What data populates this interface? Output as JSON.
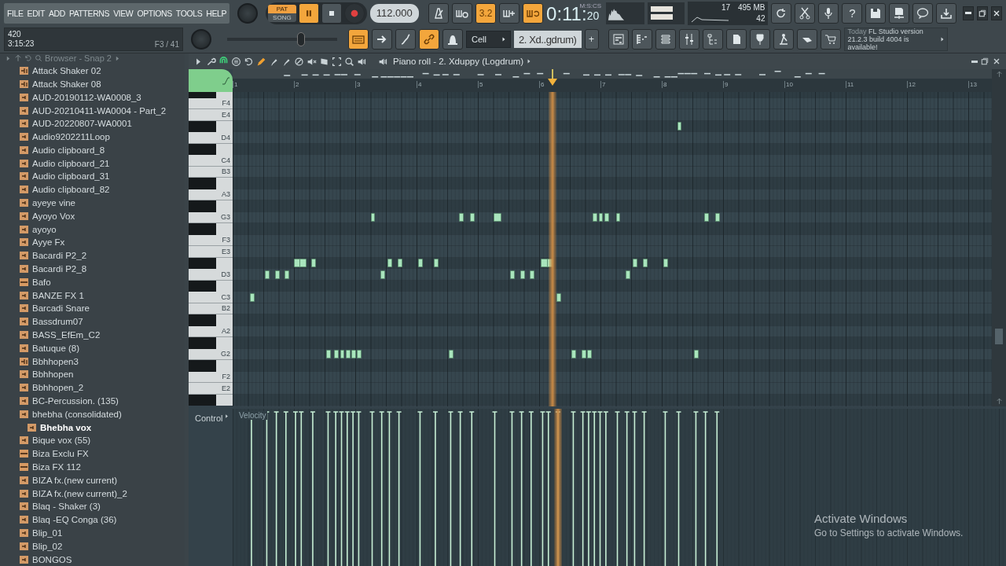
{
  "menu": [
    "FILE",
    "EDIT",
    "ADD",
    "PATTERNS",
    "VIEW",
    "OPTIONS",
    "TOOLS",
    "HELP"
  ],
  "hint_panel": {
    "line_1": "420",
    "line_2": "3:15:23",
    "position": "F3 / 41"
  },
  "transport": {
    "pat_label": "PAT",
    "song_label": "SONG",
    "pattern_mode": true,
    "playing": true
  },
  "tempo": "112.000",
  "row_1_toggles": [
    {
      "on": false
    },
    {
      "on": false
    },
    {
      "on": true,
      "label": "3.2"
    },
    {
      "on": false
    },
    {
      "on": true
    }
  ],
  "time": {
    "unit": "M:S:CS",
    "main": "0:11:",
    "small": "20"
  },
  "monitor": {
    "cpu": "17",
    "memory": "495 MB",
    "polyphony": "42"
  },
  "help_label": "?",
  "main_slider": {
    "level": 0.67
  },
  "row_2_toggles": [
    {
      "on": true
    },
    {
      "on": false
    },
    {
      "on": false
    },
    {
      "on": true
    },
    {
      "on": false
    }
  ],
  "snap": "Cell",
  "pattern": "2. Xd..gdrum)",
  "add_pattern": "+",
  "news": {
    "day": "Today",
    "text": "FL Studio version 21.2.3 build 4004 is available!"
  },
  "browser": {
    "title": "Browser - Snap 2",
    "items": [
      {
        "name": "Attack Shaker 02",
        "kind": "loop",
        "selected": false
      },
      {
        "name": "Attack Shaker 08",
        "kind": "loop",
        "selected": false
      },
      {
        "name": "AUD-20190112-WA0008_3",
        "kind": "audio",
        "selected": false
      },
      {
        "name": "AUD-20210411-WA0004 - Part_2",
        "kind": "audio",
        "selected": false
      },
      {
        "name": "AUD-20220807-WA0001",
        "kind": "audio",
        "selected": false
      },
      {
        "name": "Audio9202211Loop",
        "kind": "audio",
        "selected": false
      },
      {
        "name": "Audio clipboard_8",
        "kind": "audio",
        "selected": false
      },
      {
        "name": "Audio clipboard_21",
        "kind": "audio",
        "selected": false
      },
      {
        "name": "Audio clipboard_31",
        "kind": "audio",
        "selected": false
      },
      {
        "name": "Audio clipboard_82",
        "kind": "audio",
        "selected": false
      },
      {
        "name": "ayeye vine",
        "kind": "audio",
        "selected": false
      },
      {
        "name": "Ayoyo Vox",
        "kind": "audio",
        "selected": false
      },
      {
        "name": "ayoyo",
        "kind": "audio",
        "selected": false
      },
      {
        "name": "Ayye Fx",
        "kind": "audio",
        "selected": false
      },
      {
        "name": "Bacardi P2_2",
        "kind": "audio",
        "selected": false
      },
      {
        "name": "Bacardi P2_8",
        "kind": "audio",
        "selected": false
      },
      {
        "name": "Bafo",
        "kind": "mp3",
        "selected": false
      },
      {
        "name": "BANZE FX 1",
        "kind": "audio",
        "selected": false
      },
      {
        "name": "Barcadi Snare",
        "kind": "audio",
        "selected": false
      },
      {
        "name": "Bassdrum07",
        "kind": "audio",
        "selected": false
      },
      {
        "name": "BASS_EfEm_C2",
        "kind": "audio",
        "selected": false
      },
      {
        "name": "Batuque  (8)",
        "kind": "audio",
        "selected": false
      },
      {
        "name": "Bbhhopen3",
        "kind": "loop",
        "selected": false
      },
      {
        "name": "Bbhhopen",
        "kind": "audio",
        "selected": false
      },
      {
        "name": "Bbhhopen_2",
        "kind": "audio",
        "selected": false
      },
      {
        "name": "BC-Percussion. (135)",
        "kind": "audio",
        "selected": false
      },
      {
        "name": "bhebha (consolidated)",
        "kind": "audio",
        "selected": false,
        "children": [
          {
            "name": "Bhebha vox",
            "kind": "audio",
            "selected": true
          }
        ]
      },
      {
        "name": "Bique vox (55)",
        "kind": "audio",
        "selected": false
      },
      {
        "name": "Biza Exclu FX",
        "kind": "mp3",
        "selected": false
      },
      {
        "name": "Biza FX 112",
        "kind": "mp3",
        "selected": false
      },
      {
        "name": "BIZA fx.(new current)",
        "kind": "audio",
        "selected": false
      },
      {
        "name": "BIZA fx.(new current)_2",
        "kind": "audio",
        "selected": false
      },
      {
        "name": "Blaq - Shaker  (3)",
        "kind": "audio",
        "selected": false
      },
      {
        "name": "Blaq -EQ Conga (36)",
        "kind": "audio",
        "selected": false
      },
      {
        "name": "Blip_01",
        "kind": "audio",
        "selected": false
      },
      {
        "name": "Blip_02",
        "kind": "audio",
        "selected": false
      },
      {
        "name": "BONGOS",
        "kind": "audio",
        "selected": false
      }
    ]
  },
  "piano_roll": {
    "title": "Piano roll - 2. Xduppy (Logdrum)",
    "bars": [
      "1",
      "2",
      "3",
      "4",
      "5",
      "6",
      "7",
      "8",
      "9",
      "10",
      "11",
      "12",
      "13"
    ],
    "keys": [
      {
        "kind": "black"
      },
      {
        "kind": "white",
        "label": "F4"
      },
      {
        "kind": "white",
        "label": "E4"
      },
      {
        "kind": "black"
      },
      {
        "kind": "white",
        "label": "D4"
      },
      {
        "kind": "black"
      },
      {
        "kind": "white",
        "label": "C4"
      },
      {
        "kind": "white",
        "label": "B3"
      },
      {
        "kind": "black"
      },
      {
        "kind": "white",
        "label": "A3"
      },
      {
        "kind": "black"
      },
      {
        "kind": "white",
        "label": "G3"
      },
      {
        "kind": "black"
      },
      {
        "kind": "white",
        "label": "F3"
      },
      {
        "kind": "white",
        "label": "E3"
      },
      {
        "kind": "black"
      },
      {
        "kind": "white",
        "label": "D3"
      },
      {
        "kind": "black"
      },
      {
        "kind": "white",
        "label": "C3"
      },
      {
        "kind": "white",
        "label": "B2"
      },
      {
        "kind": "black"
      },
      {
        "kind": "white",
        "label": "A2"
      },
      {
        "kind": "black"
      },
      {
        "kind": "white",
        "label": "G2"
      },
      {
        "kind": "black"
      },
      {
        "kind": "white",
        "label": "F2"
      },
      {
        "kind": "white",
        "label": "E2"
      },
      {
        "kind": "black"
      }
    ],
    "playhead": {
      "level": 0.421
    },
    "control": {
      "label": "Control",
      "target": "Velocity"
    }
  },
  "os_notice": {
    "title": "Activate Windows",
    "text": "Go to Settings to activate Windows."
  }
}
